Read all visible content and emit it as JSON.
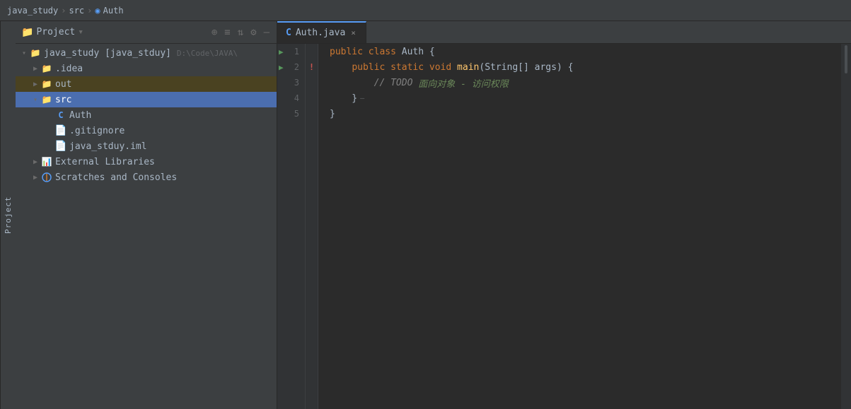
{
  "breadcrumb": {
    "project": "java_study",
    "separator1": "›",
    "src": "src",
    "separator2": "›",
    "file": "Auth"
  },
  "sidebar_label": "Project",
  "project_panel": {
    "title": "Project",
    "dropdown_arrow": "▾",
    "icons": {
      "add": "+",
      "list": "≡",
      "expand": "⇅",
      "settings": "⚙",
      "minimize": "—"
    }
  },
  "file_tree": {
    "root": {
      "label": "java_study [java_stduy]",
      "suffix": "D:\\Code\\JAVA\\",
      "expanded": true,
      "children": [
        {
          "id": "idea",
          "label": ".idea",
          "type": "folder",
          "expanded": false,
          "indent": 1
        },
        {
          "id": "out",
          "label": "out",
          "type": "folder",
          "expanded": false,
          "indent": 1,
          "highlighted": true
        },
        {
          "id": "src",
          "label": "src",
          "type": "folder",
          "expanded": true,
          "indent": 1,
          "selected": true,
          "children": [
            {
              "id": "auth",
              "label": "Auth",
              "type": "java-class",
              "indent": 2
            },
            {
              "id": "gitignore",
              "label": ".gitignore",
              "type": "gitignore",
              "indent": 2
            },
            {
              "id": "iml",
              "label": "java_stduy.iml",
              "type": "iml",
              "indent": 2
            }
          ]
        },
        {
          "id": "external-libraries",
          "label": "External Libraries",
          "type": "external",
          "expanded": false,
          "indent": 1
        },
        {
          "id": "scratches",
          "label": "Scratches and Consoles",
          "type": "scratches",
          "expanded": false,
          "indent": 1
        }
      ]
    }
  },
  "tab": {
    "label": "Auth.java",
    "icon": "java-icon",
    "close": "×"
  },
  "code_lines": [
    {
      "num": 1,
      "has_run": true,
      "has_error": false,
      "has_fold": false,
      "tokens": [
        {
          "t": "kw",
          "v": "public"
        },
        {
          "t": "punct",
          "v": " "
        },
        {
          "t": "kw",
          "v": "class"
        },
        {
          "t": "punct",
          "v": " "
        },
        {
          "t": "cn",
          "v": "Auth"
        },
        {
          "t": "punct",
          "v": " {"
        }
      ]
    },
    {
      "num": 2,
      "has_run": true,
      "has_error": true,
      "has_fold": false,
      "tokens": [
        {
          "t": "punct",
          "v": "    "
        },
        {
          "t": "kw",
          "v": "public"
        },
        {
          "t": "punct",
          "v": " "
        },
        {
          "t": "kw",
          "v": "static"
        },
        {
          "t": "punct",
          "v": " "
        },
        {
          "t": "kw",
          "v": "void"
        },
        {
          "t": "punct",
          "v": " "
        },
        {
          "t": "fn",
          "v": "main"
        },
        {
          "t": "punct",
          "v": "("
        },
        {
          "t": "cn",
          "v": "String"
        },
        {
          "t": "punct",
          "v": "[] "
        },
        {
          "t": "cn",
          "v": "args"
        },
        {
          "t": "punct",
          "v": ") {"
        }
      ]
    },
    {
      "num": 3,
      "has_run": false,
      "has_error": false,
      "has_fold": false,
      "tokens": [
        {
          "t": "punct",
          "v": "        "
        },
        {
          "t": "comment",
          "v": "// TODO"
        },
        {
          "t": "comment-cn",
          "v": " 面向对象 - 访问权限"
        }
      ]
    },
    {
      "num": 4,
      "has_run": false,
      "has_error": false,
      "has_fold": true,
      "tokens": [
        {
          "t": "punct",
          "v": "    }"
        }
      ]
    },
    {
      "num": 5,
      "has_run": false,
      "has_error": false,
      "has_fold": false,
      "tokens": [
        {
          "t": "punct",
          "v": "}"
        }
      ]
    }
  ]
}
